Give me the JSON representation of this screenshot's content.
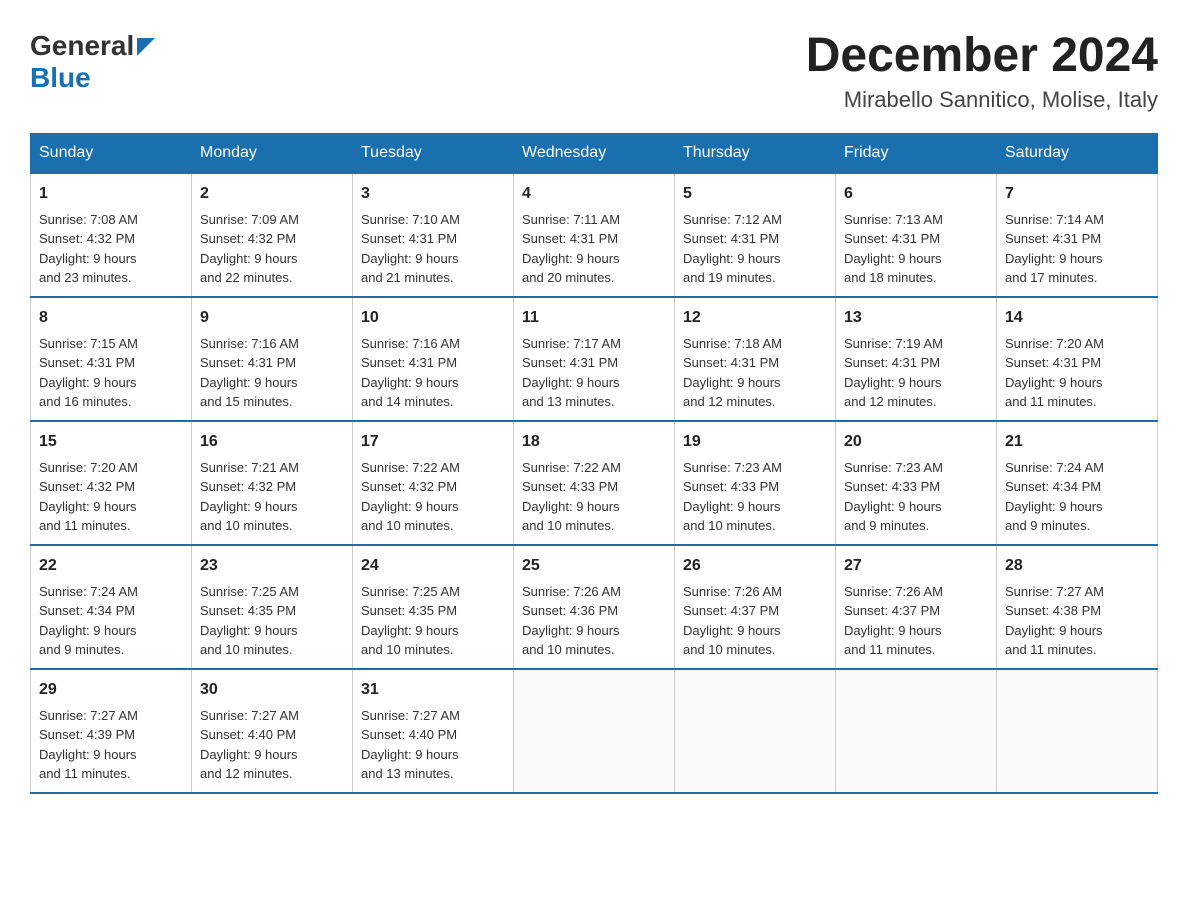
{
  "logo": {
    "general": "General",
    "blue": "Blue"
  },
  "title": "December 2024",
  "subtitle": "Mirabello Sannitico, Molise, Italy",
  "days": [
    "Sunday",
    "Monday",
    "Tuesday",
    "Wednesday",
    "Thursday",
    "Friday",
    "Saturday"
  ],
  "weeks": [
    [
      {
        "day": 1,
        "sunrise": "7:08 AM",
        "sunset": "4:32 PM",
        "daylight": "9 hours and 23 minutes."
      },
      {
        "day": 2,
        "sunrise": "7:09 AM",
        "sunset": "4:32 PM",
        "daylight": "9 hours and 22 minutes."
      },
      {
        "day": 3,
        "sunrise": "7:10 AM",
        "sunset": "4:31 PM",
        "daylight": "9 hours and 21 minutes."
      },
      {
        "day": 4,
        "sunrise": "7:11 AM",
        "sunset": "4:31 PM",
        "daylight": "9 hours and 20 minutes."
      },
      {
        "day": 5,
        "sunrise": "7:12 AM",
        "sunset": "4:31 PM",
        "daylight": "9 hours and 19 minutes."
      },
      {
        "day": 6,
        "sunrise": "7:13 AM",
        "sunset": "4:31 PM",
        "daylight": "9 hours and 18 minutes."
      },
      {
        "day": 7,
        "sunrise": "7:14 AM",
        "sunset": "4:31 PM",
        "daylight": "9 hours and 17 minutes."
      }
    ],
    [
      {
        "day": 8,
        "sunrise": "7:15 AM",
        "sunset": "4:31 PM",
        "daylight": "9 hours and 16 minutes."
      },
      {
        "day": 9,
        "sunrise": "7:16 AM",
        "sunset": "4:31 PM",
        "daylight": "9 hours and 15 minutes."
      },
      {
        "day": 10,
        "sunrise": "7:16 AM",
        "sunset": "4:31 PM",
        "daylight": "9 hours and 14 minutes."
      },
      {
        "day": 11,
        "sunrise": "7:17 AM",
        "sunset": "4:31 PM",
        "daylight": "9 hours and 13 minutes."
      },
      {
        "day": 12,
        "sunrise": "7:18 AM",
        "sunset": "4:31 PM",
        "daylight": "9 hours and 12 minutes."
      },
      {
        "day": 13,
        "sunrise": "7:19 AM",
        "sunset": "4:31 PM",
        "daylight": "9 hours and 12 minutes."
      },
      {
        "day": 14,
        "sunrise": "7:20 AM",
        "sunset": "4:31 PM",
        "daylight": "9 hours and 11 minutes."
      }
    ],
    [
      {
        "day": 15,
        "sunrise": "7:20 AM",
        "sunset": "4:32 PM",
        "daylight": "9 hours and 11 minutes."
      },
      {
        "day": 16,
        "sunrise": "7:21 AM",
        "sunset": "4:32 PM",
        "daylight": "9 hours and 10 minutes."
      },
      {
        "day": 17,
        "sunrise": "7:22 AM",
        "sunset": "4:32 PM",
        "daylight": "9 hours and 10 minutes."
      },
      {
        "day": 18,
        "sunrise": "7:22 AM",
        "sunset": "4:33 PM",
        "daylight": "9 hours and 10 minutes."
      },
      {
        "day": 19,
        "sunrise": "7:23 AM",
        "sunset": "4:33 PM",
        "daylight": "9 hours and 10 minutes."
      },
      {
        "day": 20,
        "sunrise": "7:23 AM",
        "sunset": "4:33 PM",
        "daylight": "9 hours and 9 minutes."
      },
      {
        "day": 21,
        "sunrise": "7:24 AM",
        "sunset": "4:34 PM",
        "daylight": "9 hours and 9 minutes."
      }
    ],
    [
      {
        "day": 22,
        "sunrise": "7:24 AM",
        "sunset": "4:34 PM",
        "daylight": "9 hours and 9 minutes."
      },
      {
        "day": 23,
        "sunrise": "7:25 AM",
        "sunset": "4:35 PM",
        "daylight": "9 hours and 10 minutes."
      },
      {
        "day": 24,
        "sunrise": "7:25 AM",
        "sunset": "4:35 PM",
        "daylight": "9 hours and 10 minutes."
      },
      {
        "day": 25,
        "sunrise": "7:26 AM",
        "sunset": "4:36 PM",
        "daylight": "9 hours and 10 minutes."
      },
      {
        "day": 26,
        "sunrise": "7:26 AM",
        "sunset": "4:37 PM",
        "daylight": "9 hours and 10 minutes."
      },
      {
        "day": 27,
        "sunrise": "7:26 AM",
        "sunset": "4:37 PM",
        "daylight": "9 hours and 11 minutes."
      },
      {
        "day": 28,
        "sunrise": "7:27 AM",
        "sunset": "4:38 PM",
        "daylight": "9 hours and 11 minutes."
      }
    ],
    [
      {
        "day": 29,
        "sunrise": "7:27 AM",
        "sunset": "4:39 PM",
        "daylight": "9 hours and 11 minutes."
      },
      {
        "day": 30,
        "sunrise": "7:27 AM",
        "sunset": "4:40 PM",
        "daylight": "9 hours and 12 minutes."
      },
      {
        "day": 31,
        "sunrise": "7:27 AM",
        "sunset": "4:40 PM",
        "daylight": "9 hours and 13 minutes."
      },
      null,
      null,
      null,
      null
    ]
  ],
  "labels": {
    "sunrise": "Sunrise:",
    "sunset": "Sunset:",
    "daylight": "Daylight:"
  }
}
